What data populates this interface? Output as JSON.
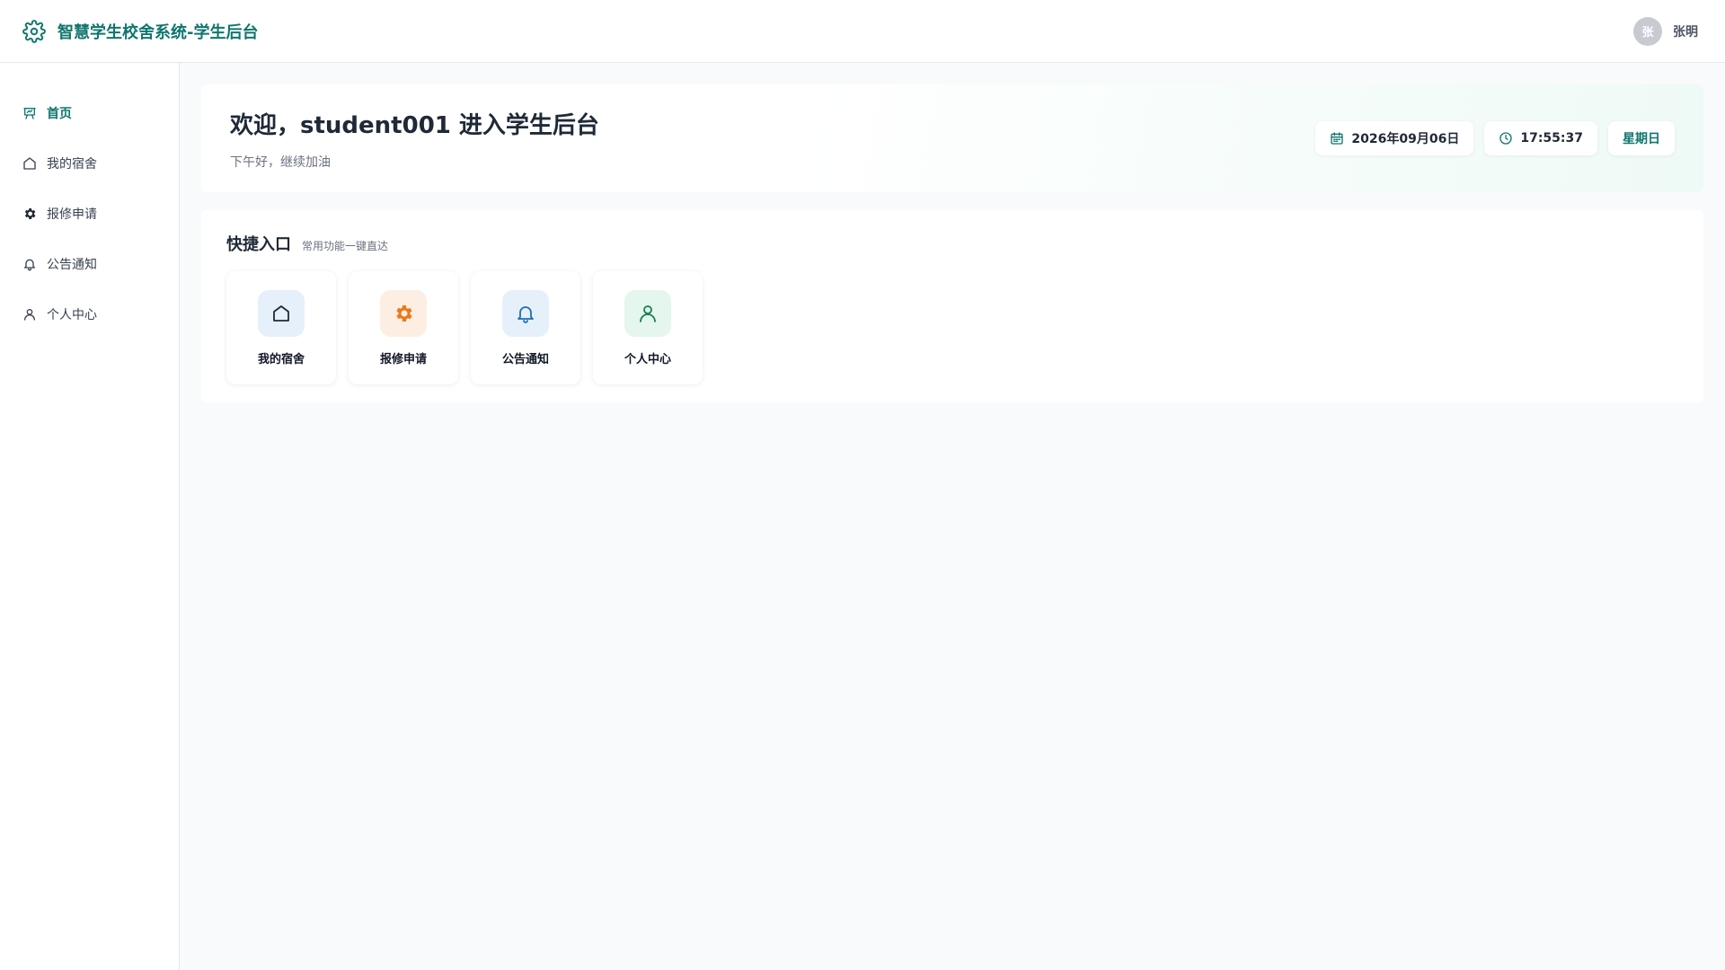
{
  "header": {
    "title": "智慧学生校舍系统-学生后台",
    "brand_icon": "gear-icon",
    "user": {
      "avatar_text": "张",
      "name": "张明"
    }
  },
  "sidebar": {
    "items": [
      {
        "label": "首页",
        "icon": "chart-presentation-icon",
        "active": true
      },
      {
        "label": "我的宿舍",
        "icon": "home-icon",
        "active": false
      },
      {
        "label": "报修申请",
        "icon": "gear-icon",
        "active": false
      },
      {
        "label": "公告通知",
        "icon": "bell-icon",
        "active": false
      },
      {
        "label": "个人中心",
        "icon": "user-icon",
        "active": false
      }
    ]
  },
  "welcome": {
    "title": "欢迎，student001 进入学生后台",
    "subtitle": "下午好，继续加油",
    "date": "2026年09月06日",
    "time": "17:55:37",
    "weekday": "星期日"
  },
  "quick": {
    "title": "快捷入口",
    "subtitle": "常用功能一键直达",
    "tiles": [
      {
        "label": "我的宿舍",
        "icon": "home-icon",
        "color": "#1f2937",
        "bg": "#e6f0fb"
      },
      {
        "label": "报修申请",
        "icon": "gear-icon",
        "color": "#ea7a1d",
        "bg": "#fdeee3"
      },
      {
        "label": "公告通知",
        "icon": "bell-icon",
        "color": "#1f6fb2",
        "bg": "#e6f0fb"
      },
      {
        "label": "个人中心",
        "icon": "user-icon",
        "color": "#15804f",
        "bg": "#e4f6ee"
      }
    ]
  },
  "colors": {
    "accent": "#0f766e",
    "background": "#f8fafc"
  }
}
